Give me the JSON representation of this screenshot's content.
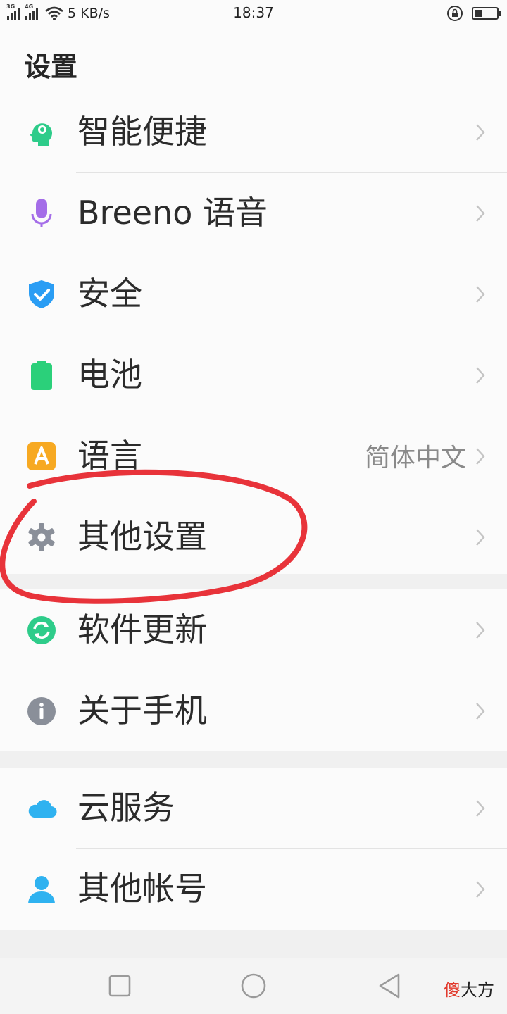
{
  "status_bar": {
    "network_left": "3G",
    "network_right": "4G",
    "speed": "5 KB/s",
    "time": "18:37",
    "battery_level": 0.35
  },
  "header": {
    "title": "设置"
  },
  "groups": [
    {
      "items": [
        {
          "label": "智能便捷",
          "icon": "smart-head-icon",
          "color": "#2ecc8a"
        },
        {
          "label": "Breeno 语音",
          "icon": "microphone-icon",
          "color": "#a46de8"
        },
        {
          "label": "安全",
          "icon": "shield-icon",
          "color": "#2a9df4"
        },
        {
          "label": "电池",
          "icon": "battery-icon",
          "color": "#2bd07a"
        },
        {
          "label": "语言",
          "value": "简体中文",
          "icon": "language-icon",
          "color": "#f7a922"
        },
        {
          "label": "其他设置",
          "icon": "gear-icon",
          "color": "#8a8f99"
        }
      ]
    },
    {
      "items": [
        {
          "label": "软件更新",
          "icon": "update-icon",
          "color": "#2ecc8a"
        },
        {
          "label": "关于手机",
          "icon": "info-icon",
          "color": "#8a8f99"
        }
      ]
    },
    {
      "items": [
        {
          "label": "云服务",
          "icon": "cloud-icon",
          "color": "#2fb2f0"
        },
        {
          "label": "其他帐号",
          "icon": "person-icon",
          "color": "#2fb2f0"
        }
      ]
    }
  ],
  "annotation": {
    "color": "#e8333a",
    "target": "其他设置"
  },
  "watermark": {
    "first_char": "傻",
    "rest": "大方"
  },
  "nav": {
    "buttons": [
      "recent-apps",
      "home",
      "back"
    ]
  }
}
